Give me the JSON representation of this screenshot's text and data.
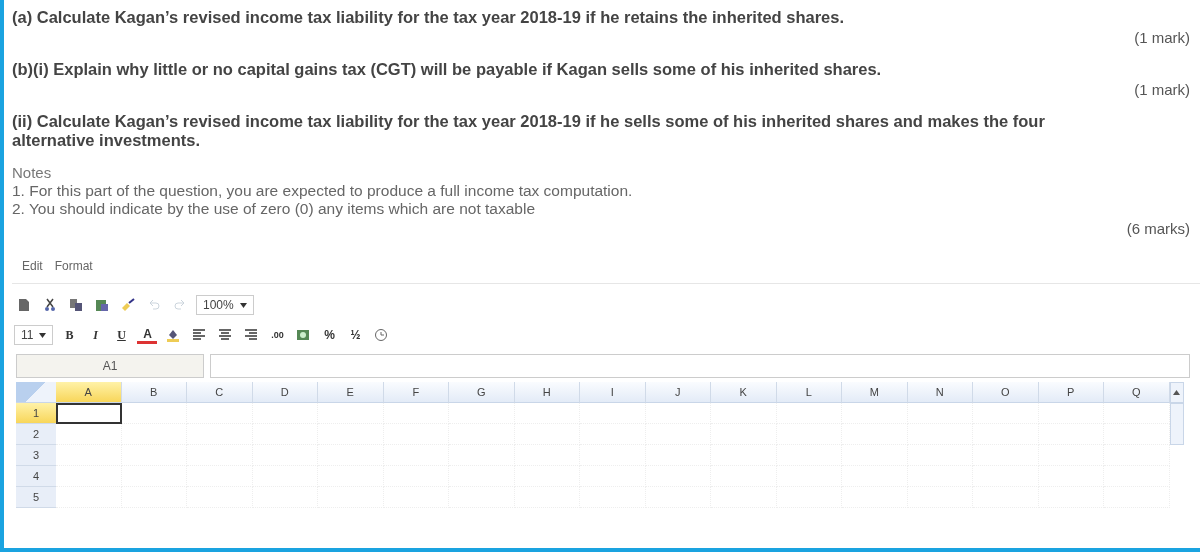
{
  "questions": [
    {
      "text": "(a) Calculate Kagan’s revised income tax liability for the tax year 2018-19 if he retains the inherited shares.",
      "marks": "(1 mark)"
    },
    {
      "text": "(b)(i) Explain why little or no capital gains tax (CGT) will be payable if Kagan sells some of his inherited shares.",
      "marks": "(1 mark)"
    },
    {
      "text": "(ii) Calculate Kagan’s revised income tax liability for the tax year 2018-19 if he sells some of his inherited shares and makes the four alternative investments.",
      "notes_title": "Notes",
      "notes": [
        "1. For this part of the question, you are expected to produce a full income tax computation.",
        "2. You should indicate by the use of zero (0) any items which are not taxable"
      ],
      "marks": "(6 marks)"
    }
  ],
  "menu": [
    "Edit",
    "Format"
  ],
  "toolbar_1": [
    {
      "kind": "new"
    },
    {
      "kind": "cut"
    },
    {
      "kind": "copy"
    },
    {
      "kind": "paste"
    },
    {
      "kind": "brush"
    },
    {
      "kind": "undo",
      "disabled": true
    },
    {
      "kind": "redo",
      "disabled": true
    },
    {
      "kind": "select",
      "label": "100%"
    }
  ],
  "toolbar_2": [
    {
      "kind": "select",
      "label": "11"
    },
    {
      "kind": "bold",
      "label": "B"
    },
    {
      "kind": "italic",
      "label": "I"
    },
    {
      "kind": "underline",
      "label": "U"
    },
    {
      "kind": "color",
      "label": "A"
    },
    {
      "kind": "fill"
    },
    {
      "kind": "align-left"
    },
    {
      "kind": "align-center"
    },
    {
      "kind": "align-right"
    },
    {
      "kind": "text",
      "label": ".00"
    },
    {
      "kind": "money"
    },
    {
      "kind": "text",
      "label": "%"
    },
    {
      "kind": "text",
      "label": "½"
    },
    {
      "kind": "clock"
    }
  ],
  "name_box": "A1",
  "columns": [
    {
      "label": "A",
      "selected": true
    },
    {
      "label": "B",
      "selected": false
    },
    {
      "label": "C",
      "selected": false
    },
    {
      "label": "D",
      "selected": false
    },
    {
      "label": "E",
      "selected": false
    },
    {
      "label": "F",
      "selected": false
    },
    {
      "label": "G",
      "selected": false
    },
    {
      "label": "H",
      "selected": false
    },
    {
      "label": "I",
      "selected": false
    },
    {
      "label": "J",
      "selected": false
    },
    {
      "label": "K",
      "selected": false
    },
    {
      "label": "L",
      "selected": false
    },
    {
      "label": "M",
      "selected": false
    },
    {
      "label": "N",
      "selected": false
    },
    {
      "label": "O",
      "selected": false
    },
    {
      "label": "P",
      "selected": false
    },
    {
      "label": "Q",
      "selected": false
    }
  ],
  "rows": [
    {
      "label": "1",
      "selected": true
    },
    {
      "label": "2",
      "selected": false
    },
    {
      "label": "3",
      "selected": false
    },
    {
      "label": "4",
      "selected": false
    },
    {
      "label": "5",
      "selected": false
    }
  ]
}
